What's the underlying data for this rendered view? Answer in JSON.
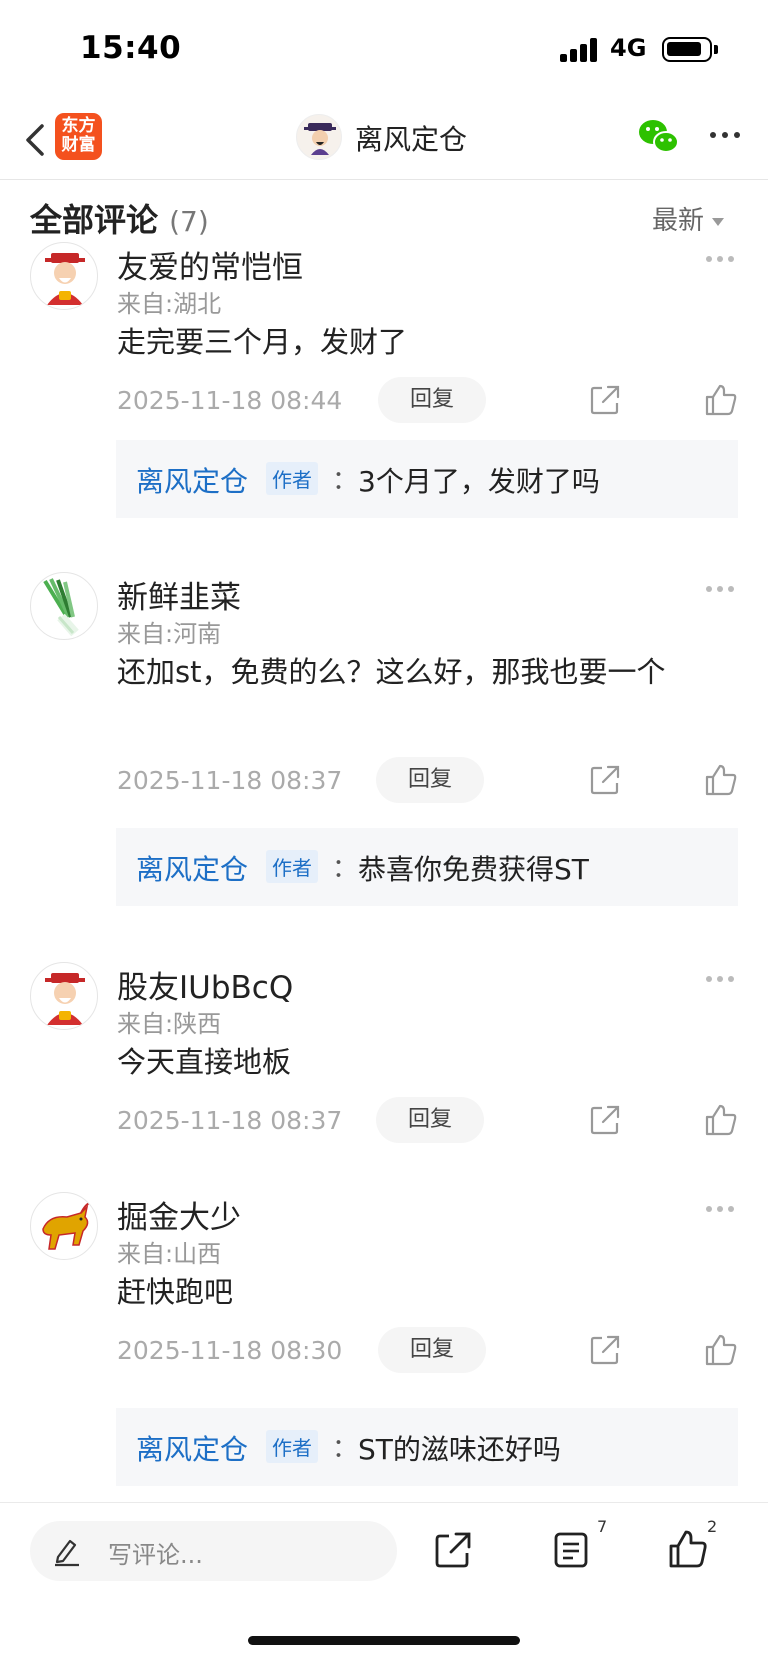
{
  "status_bar": {
    "time": "15:40",
    "network": "4G"
  },
  "nav": {
    "app_logo": "东方财富",
    "title": "离风定仓"
  },
  "header": {
    "title": "全部评论",
    "count": "(7)",
    "sort_label": "最新"
  },
  "comments": [
    {
      "username": "友爱的常恺恒",
      "location": "来自:湖北",
      "text": "走完要三个月，发财了",
      "timestamp": "2025-11-18 08:44",
      "reply_label": "回复",
      "avatar": "god-of-wealth-avatar",
      "author_reply": {
        "name": "离风定仓",
        "badge": "作者",
        "colon": "：",
        "text": "3个月了，发财了吗"
      }
    },
    {
      "username": "新鲜韭菜",
      "location": "来自:河南",
      "text": "还加st，免费的么？这么好，那我也要一个",
      "timestamp": "2025-11-18 08:37",
      "reply_label": "回复",
      "avatar": "chives-avatar",
      "author_reply": {
        "name": "离风定仓",
        "badge": "作者",
        "colon": "：",
        "text": "恭喜你免费获得ST"
      }
    },
    {
      "username": "股友IUbBcQ",
      "location": "来自:陕西",
      "text": "今天直接地板",
      "timestamp": "2025-11-18 08:37",
      "reply_label": "回复",
      "avatar": "god-of-wealth-avatar"
    },
    {
      "username": "掘金大少",
      "location": "来自:山西",
      "text": "赶快跑吧",
      "timestamp": "2025-11-18 08:30",
      "reply_label": "回复",
      "avatar": "golden-bull-avatar",
      "author_reply": {
        "name": "离风定仓",
        "badge": "作者",
        "colon": "：",
        "text": "ST的滋味还好吗"
      }
    }
  ],
  "bottom_bar": {
    "placeholder": "写评论...",
    "comment_count": "7",
    "like_count": "2"
  },
  "colors": {
    "accent_blue": "#1d6fc6",
    "brand_orange": "#f4511e",
    "wechat_green": "#2dc100"
  }
}
